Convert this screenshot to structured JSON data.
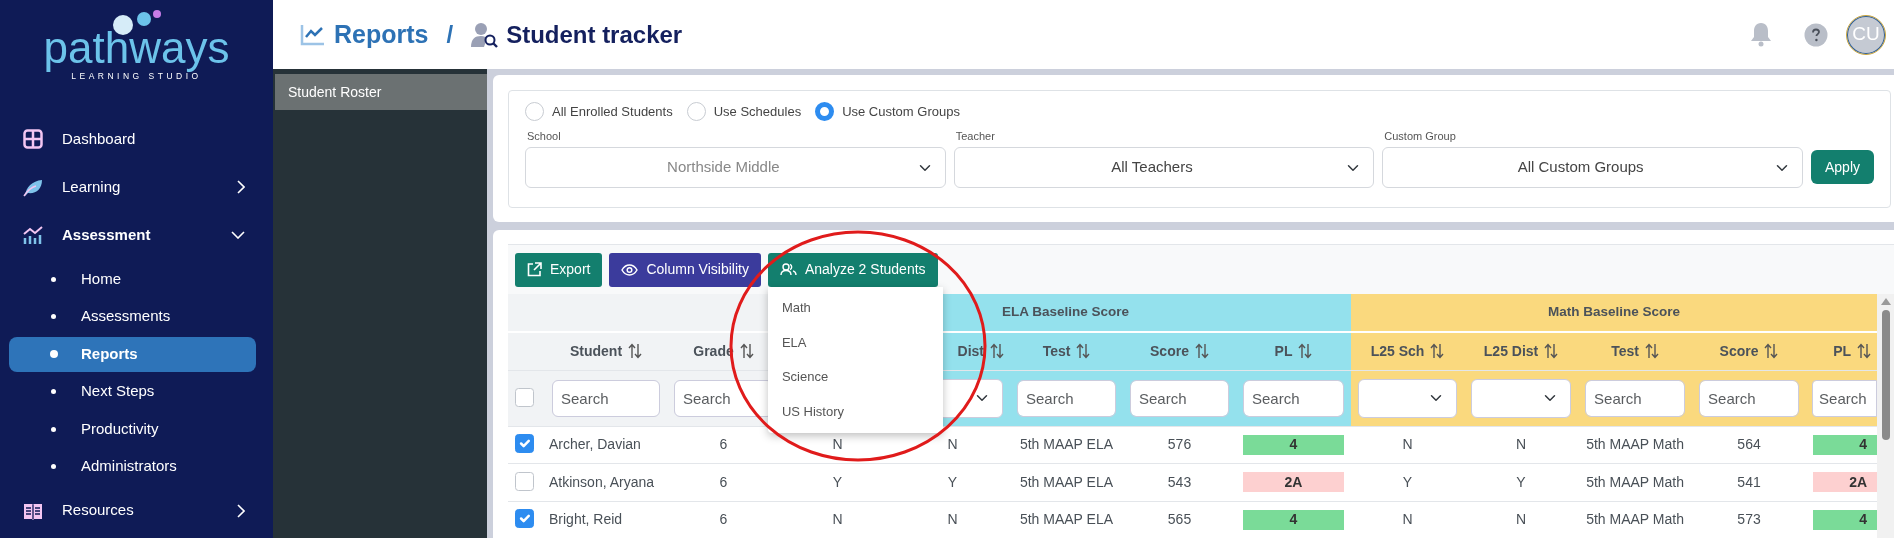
{
  "sidebar": {
    "logo": {
      "wordmark": "pathways",
      "tagline": "LEARNING STUDIO"
    },
    "items": [
      {
        "label": "Dashboard"
      },
      {
        "label": "Learning",
        "expanded": false
      },
      {
        "label": "Assessment",
        "expanded": true,
        "children": [
          {
            "label": "Home",
            "selected": false
          },
          {
            "label": "Assessments",
            "selected": false
          },
          {
            "label": "Reports",
            "selected": true
          },
          {
            "label": "Next Steps",
            "selected": false
          },
          {
            "label": "Productivity",
            "selected": false
          },
          {
            "label": "Administrators",
            "selected": false
          }
        ]
      },
      {
        "label": "Resources",
        "expanded": false
      }
    ]
  },
  "breadcrumb": {
    "parent": "Reports",
    "separator": "/",
    "current": "Student tracker"
  },
  "avatar": "CU",
  "subnav": {
    "items": [
      {
        "label": "Student Roster",
        "selected": true
      }
    ]
  },
  "filters": {
    "scopes": [
      {
        "label": "All Enrolled Students",
        "selected": false
      },
      {
        "label": "Use Schedules",
        "selected": false
      },
      {
        "label": "Use Custom Groups",
        "selected": true
      }
    ],
    "fields": [
      {
        "label": "School",
        "value": "Northside Middle",
        "disabled": true
      },
      {
        "label": "Teacher",
        "value": "All Teachers",
        "disabled": false
      },
      {
        "label": "Custom Group",
        "value": "All Custom Groups",
        "disabled": false
      }
    ],
    "apply": "Apply"
  },
  "toolbar": {
    "buttons": [
      {
        "label": "Export",
        "kind": "export"
      },
      {
        "label": "Column Visibility",
        "kind": "visibility"
      },
      {
        "label": "Analyze 2 Students",
        "kind": "analyze",
        "expanded": true,
        "menu": [
          "Math",
          "ELA",
          "Science",
          "US History"
        ]
      }
    ]
  },
  "table": {
    "select_all": false,
    "columns": [
      {
        "header": "Student",
        "kind": "search",
        "placeholder": "Search"
      },
      {
        "header": "Grade",
        "kind": "search",
        "placeholder": "Search"
      }
    ],
    "groups": [
      {
        "label": "ELA Baseline Score",
        "color": "#94e1ed",
        "columns": [
          {
            "kind": "blank"
          },
          {
            "header": "Dist",
            "kind": "select"
          },
          {
            "header": "Test",
            "kind": "search",
            "placeholder": "Search"
          },
          {
            "header": "Score",
            "kind": "search",
            "placeholder": "Search"
          },
          {
            "header": "PL",
            "kind": "search",
            "placeholder": "Search"
          }
        ]
      },
      {
        "label": "Math Baseline Score",
        "color": "#fad97e",
        "columns": [
          {
            "header": "L25 Sch",
            "kind": "select"
          },
          {
            "header": "L25 Dist",
            "kind": "select"
          },
          {
            "header": "Test",
            "kind": "search",
            "placeholder": "Search"
          },
          {
            "header": "Score",
            "kind": "search",
            "placeholder": "Search"
          },
          {
            "header": "PL",
            "kind": "search",
            "placeholder": "Search"
          }
        ]
      }
    ],
    "rows": [
      {
        "selected": true,
        "cells": [
          "Archer, Davian",
          "6",
          "N",
          "N",
          "5th MAAP ELA",
          "576",
          {
            "text": "4",
            "color": "#7adb98"
          },
          "N",
          "N",
          "5th MAAP Math",
          "564",
          {
            "text": "4",
            "color": "#7adb98"
          }
        ]
      },
      {
        "selected": false,
        "cells": [
          "Atkinson, Aryana",
          "6",
          "Y",
          "Y",
          "5th MAAP ELA",
          "543",
          {
            "text": "2A",
            "color": "#fdd0d0"
          },
          "Y",
          "Y",
          "5th MAAP Math",
          "541",
          {
            "text": "2A",
            "color": "#fdd0d0"
          }
        ]
      },
      {
        "selected": true,
        "cells": [
          "Bright, Reid",
          "6",
          "N",
          "N",
          "5th MAAP ELA",
          "565",
          {
            "text": "4",
            "color": "#7adb98"
          },
          "N",
          "N",
          "5th MAAP Math",
          "573",
          {
            "text": "4",
            "color": "#7adb98"
          }
        ]
      }
    ]
  },
  "annotation": {
    "kind": "circle"
  }
}
